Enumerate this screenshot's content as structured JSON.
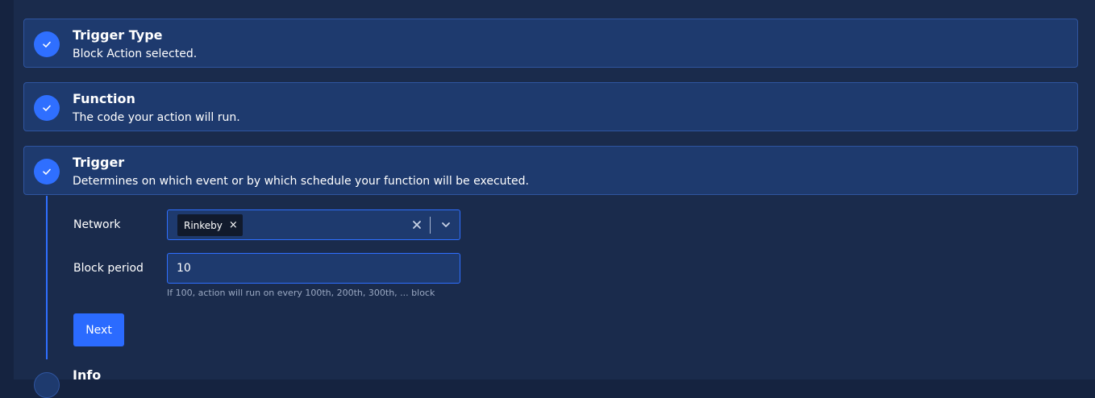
{
  "steps": [
    {
      "title": "Trigger Type",
      "description": "Block Action selected.",
      "status": "complete",
      "icon": "check-icon"
    },
    {
      "title": "Function",
      "description": "The code your action will run.",
      "status": "complete",
      "icon": "check-icon"
    },
    {
      "title": "Trigger",
      "description": "Determines on which event or by which schedule your function will be executed.",
      "status": "complete",
      "icon": "check-icon"
    }
  ],
  "form": {
    "network_label": "Network",
    "network_selected": [
      "Rinkeby"
    ],
    "block_period_label": "Block period",
    "block_period_value": "10",
    "block_period_hint": "If 100, action will run on every 100th, 200th, 300th, ... block",
    "next_label": "Next"
  },
  "next_step": {
    "title": "Info"
  },
  "colors": {
    "background": "#1a2b4c",
    "card": "#1e3a6e",
    "accent": "#2f6fff",
    "hint": "#9aa8c2"
  }
}
